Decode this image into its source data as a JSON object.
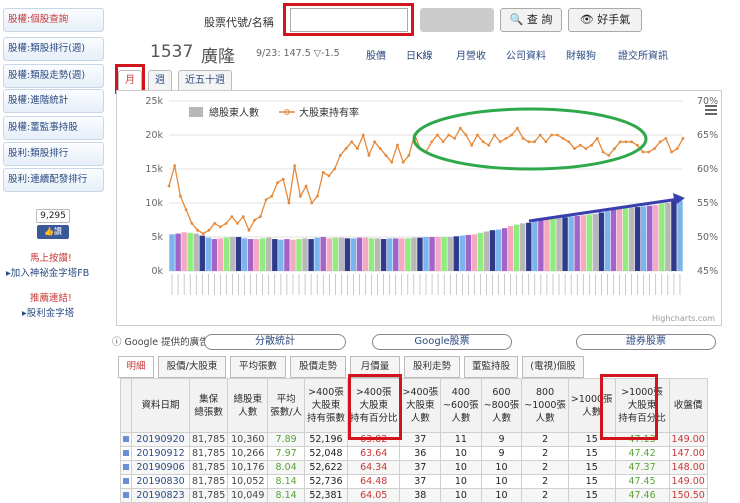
{
  "sidebar": {
    "items": [
      "股權:個股查詢",
      "股權:類股排行(週)",
      "股權:類股走勢(週)",
      "股權:進階統計",
      "股權:董監事持股",
      "股利:類股排行",
      "股利:連續配發排行"
    ],
    "fb_count": "9,295",
    "fb_label": "讚",
    "line1": "馬上按讚!",
    "line2": "加入神祕金字塔FB",
    "line3": "推薦連結!",
    "line4": "股利金字塔"
  },
  "search": {
    "label": "股票代號/名稱",
    "input_value": "",
    "query_button": "查 詢",
    "hand_button": "好手氣"
  },
  "header": {
    "code": "1537",
    "name": "廣隆",
    "info": "9/23: 147.5 ▽-1.5",
    "links": [
      "股價",
      "日K線",
      "月營收",
      "公司資料",
      "財報狗",
      "證交所資訊"
    ]
  },
  "period_tabs": [
    "月",
    "週",
    "近五十週"
  ],
  "chart_data": {
    "type": "bar+line",
    "legend": [
      "總股東人數",
      "大股東持有率"
    ],
    "legend_placement": "top-left",
    "y_left_ticks": [
      "25k",
      "20k",
      "15k",
      "10k",
      "5k",
      "0k"
    ],
    "y_left_range": [
      0,
      25000
    ],
    "y_right_ticks": [
      "70%",
      "65%",
      "60%",
      "55%",
      "50%",
      "45%"
    ],
    "y_right_range": [
      45,
      70
    ],
    "bar_colors": [
      "#7cb5ec",
      "#a463c8",
      "#f4a9c0",
      "#90ed7d",
      "#b8b8b8",
      "#2f3a8c"
    ],
    "line_color": "#e6893a",
    "holders": [
      5400,
      5500,
      5700,
      5600,
      5500,
      5200,
      4900,
      4700,
      4800,
      4900,
      5000,
      5000,
      4800,
      4700,
      4700,
      4800,
      4900,
      4700,
      4600,
      4700,
      4600,
      4700,
      4800,
      4700,
      4900,
      5000,
      4800,
      4900,
      4900,
      4800,
      4800,
      4900,
      4900,
      4800,
      4800,
      4700,
      4800,
      4800,
      4800,
      4800,
      4900,
      4900,
      5000,
      5000,
      5000,
      5000,
      5000,
      5100,
      5200,
      5300,
      5400,
      5600,
      5800,
      6000,
      6100,
      6300,
      6600,
      6800,
      7000,
      7100,
      7300,
      7500,
      7600,
      7700,
      7800,
      7900,
      8000,
      8100,
      8200,
      8300,
      8400,
      8600,
      8800,
      9000,
      9100,
      9200,
      9300,
      9400,
      9500,
      9600,
      9700,
      9900,
      10000,
      10300,
      10360
    ],
    "big_holder_pct": [
      57.5,
      60.5,
      56,
      54,
      52,
      51,
      50.5,
      51,
      52,
      51.5,
      52,
      53,
      52,
      53,
      51,
      52.5,
      53,
      55.5,
      56,
      58,
      58.5,
      55,
      60.5,
      56,
      57.5,
      55,
      56,
      59.5,
      59,
      60,
      62,
      63,
      64,
      63,
      65,
      62,
      64,
      63,
      62,
      61,
      63.5,
      61,
      62,
      65,
      63,
      62.5,
      64,
      65,
      64,
      65,
      64.5,
      66,
      65,
      63.5,
      65,
      64,
      63.5,
      65,
      64,
      64.5,
      65,
      66,
      64.5,
      64,
      64,
      65,
      64,
      65,
      65,
      64.5,
      64,
      63,
      63.5,
      63,
      63.5,
      64.5,
      62.5,
      62,
      63,
      64,
      64,
      64,
      63.5,
      62.5,
      62.5,
      63,
      64,
      64.5,
      62.5,
      63,
      64.5
    ],
    "x_labels_note": "dates (rotated, illegible)",
    "credit": "Highcharts.com"
  },
  "ads": {
    "provider": "Google 提供的廣告",
    "buttons": [
      "分散統計",
      "Google股票",
      "證券股票"
    ]
  },
  "bottom_tabs": [
    "明細",
    "股價/大股東",
    "平均張數",
    "股價走勢",
    "月價量",
    "股利走勢",
    "董監持股",
    "(電視)個股"
  ],
  "table": {
    "headers": [
      "資料日期",
      "集保\n總張數",
      "總股東\n人數",
      "平均\n張數/人",
      ">400張\n大股東\n持有張數",
      ">400張\n大股東\n持有百分比",
      ">400張\n大股東\n人數",
      "400\n~600張\n人數",
      "600\n~800張\n人數",
      "800\n~1000張\n人數",
      ">1000張\n人數",
      ">1000張\n大股東\n持有百分比",
      "收盤價"
    ],
    "rows": [
      [
        "20190920",
        "81,785",
        "10,360",
        "7.89",
        "52,196",
        "63.82",
        "37",
        "11",
        "9",
        "2",
        "15",
        "47.13",
        "149.00"
      ],
      [
        "20190912",
        "81,785",
        "10,266",
        "7.97",
        "52,048",
        "63.64",
        "36",
        "10",
        "9",
        "2",
        "15",
        "47.42",
        "147.00"
      ],
      [
        "20190906",
        "81,785",
        "10,176",
        "8.04",
        "52,622",
        "64.34",
        "37",
        "10",
        "10",
        "2",
        "15",
        "47.37",
        "148.00"
      ],
      [
        "20190830",
        "81,785",
        "10,052",
        "8.14",
        "52,736",
        "64.48",
        "37",
        "10",
        "10",
        "2",
        "15",
        "47.45",
        "149.00"
      ],
      [
        "20190823",
        "81,785",
        "10,049",
        "8.14",
        "52,381",
        "64.05",
        "38",
        "10",
        "10",
        "2",
        "15",
        "47.46",
        "150.50"
      ]
    ]
  },
  "colors": {
    "accent_red": "#d4141c",
    "green_annotation": "#2ea84a",
    "blue_arrow": "#3a3fb0",
    "link": "#2b4a80"
  }
}
